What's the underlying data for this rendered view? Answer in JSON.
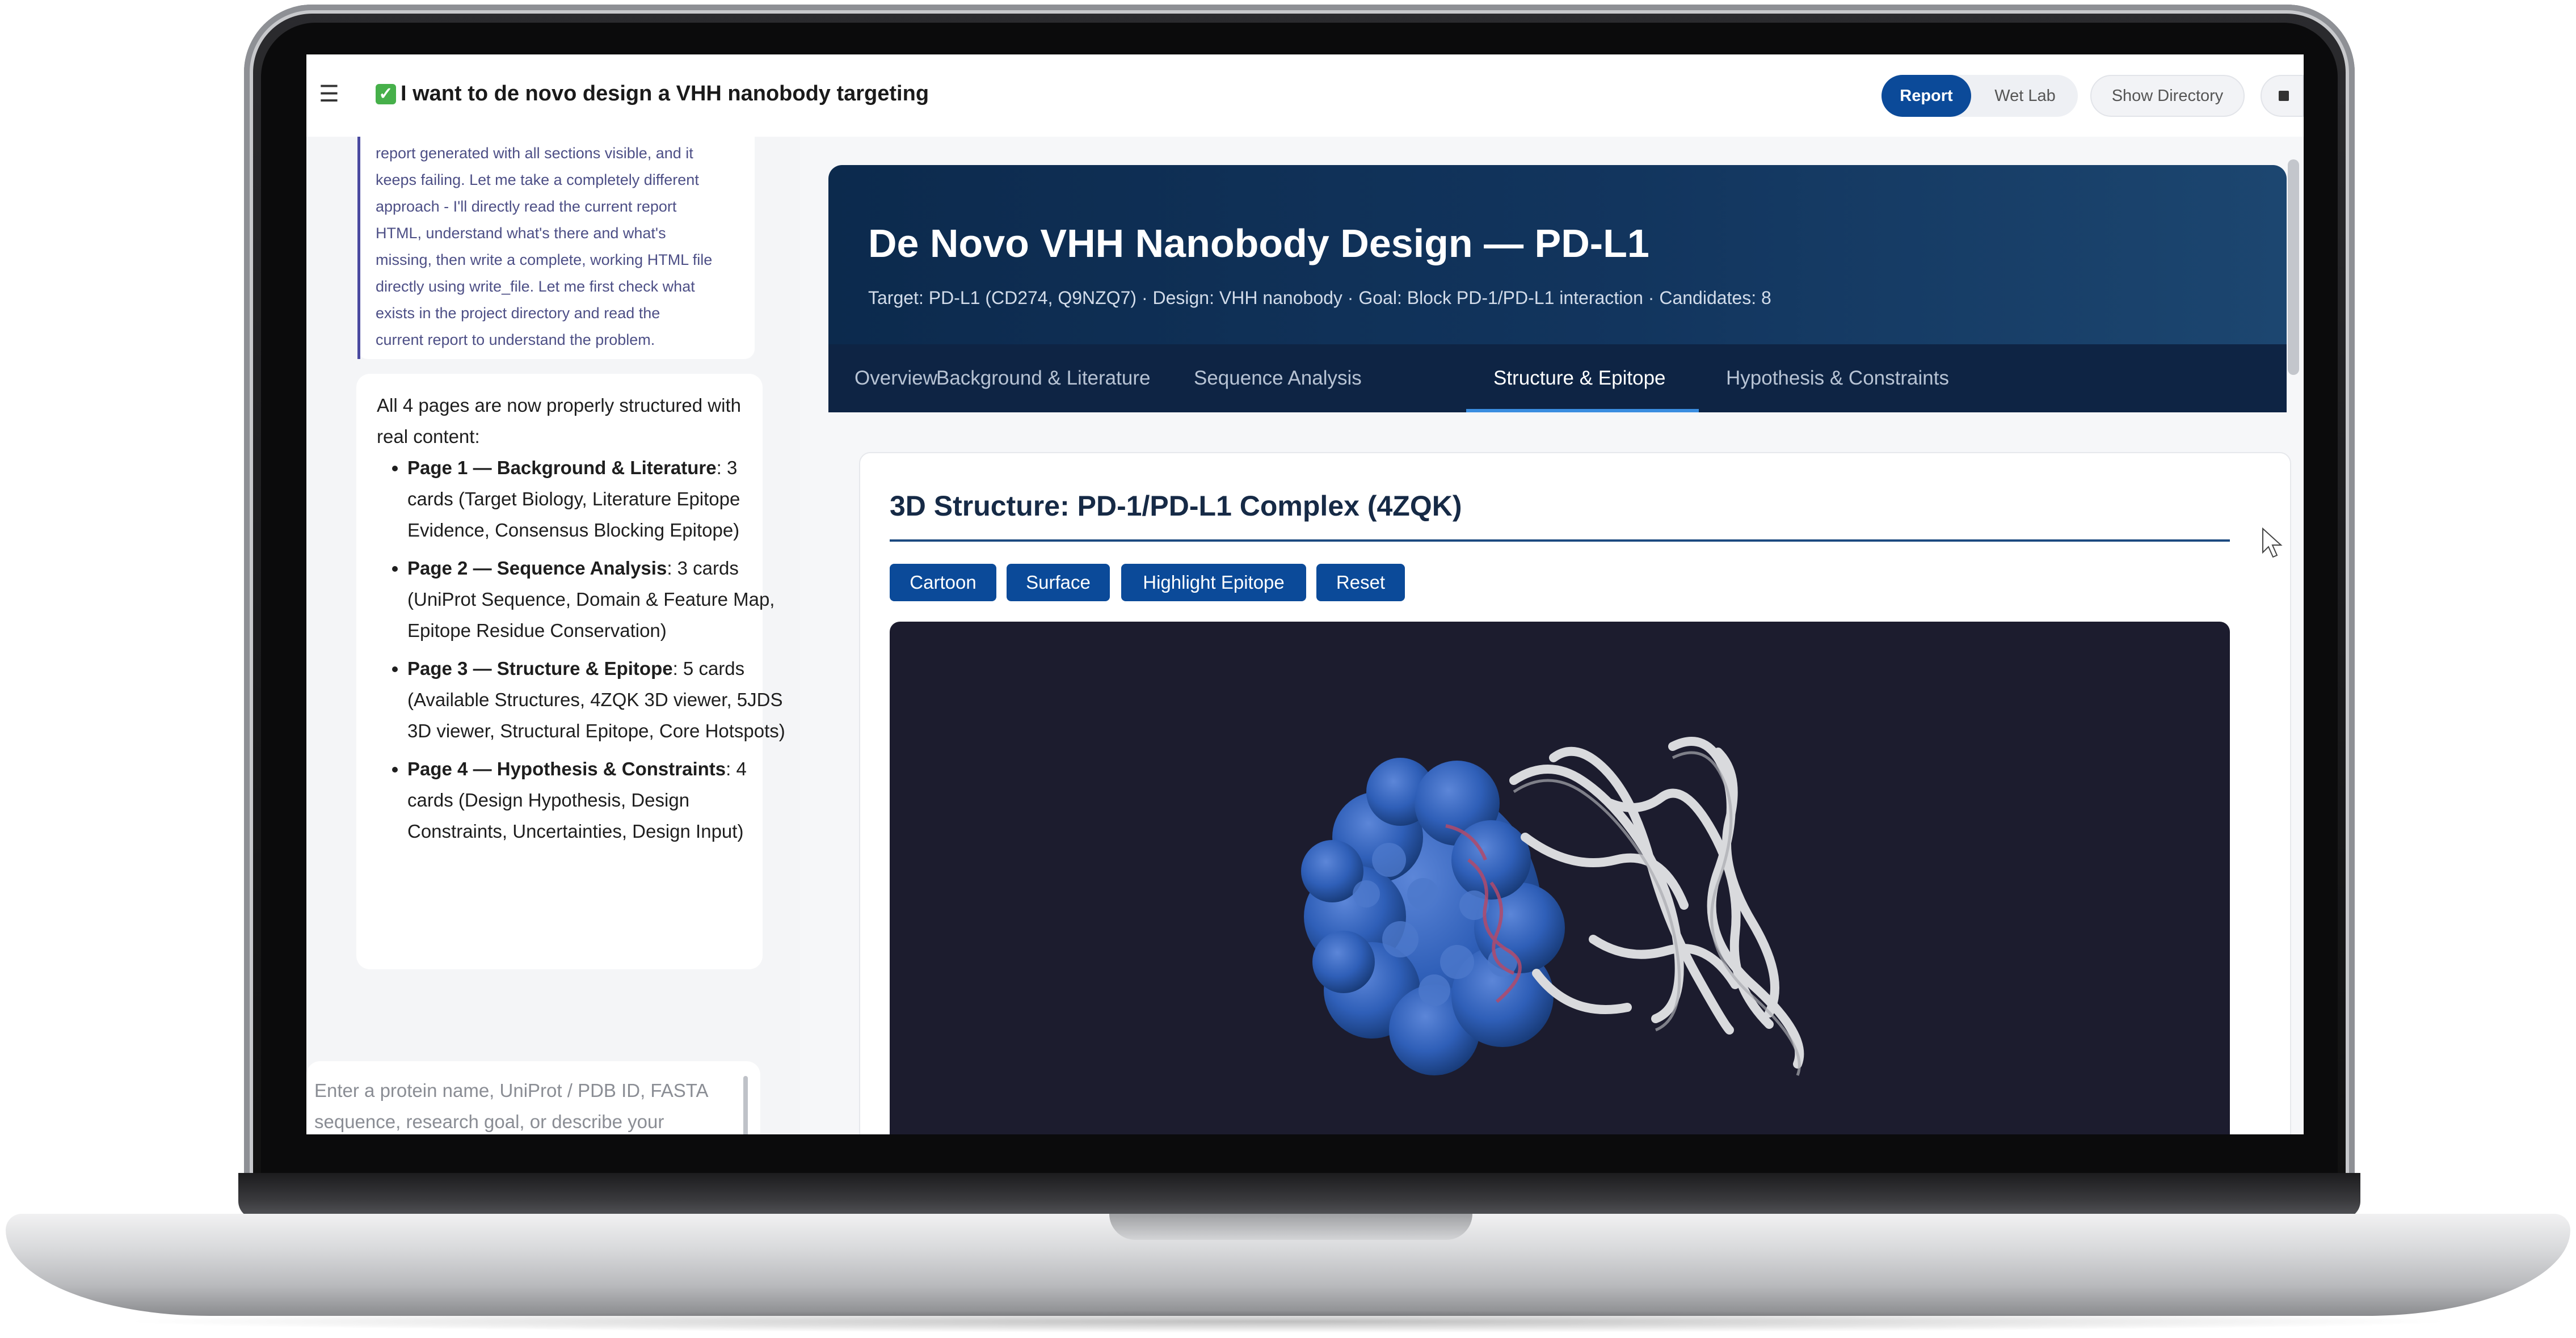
{
  "topbar": {
    "menu_icon": "hamburger-icon",
    "check_icon": "check-icon",
    "chat_title": "I want to de novo design a VHH nanobody targeting",
    "tabs": {
      "report": "Report",
      "wet_lab": "Wet Lab"
    },
    "show_directory": "Show Directory",
    "stop_icon": "stop-icon"
  },
  "chat": {
    "thought_lines": [
      "report generated with all sections visible, and it",
      "keeps failing. Let me take a completely different",
      "approach - I'll directly read the current report",
      "HTML, understand what's there and what's",
      "missing, then write a complete, working HTML file",
      "directly using write_file. Let me first check what",
      "exists in the project directory and read the",
      "current report to understand the problem."
    ],
    "message_intro": "All 4 pages are now properly structured with real content:",
    "items": [
      {
        "bold": "Page 1 — Background & Literature",
        "text": ": 3 cards (Target Biology, Literature Epitope Evidence, Consensus Blocking Epitope)"
      },
      {
        "bold": "Page 2 — Sequence Analysis",
        "text": ": 3 cards (UniProt Sequence, Domain & Feature Map, Epitope Residue Conservation)"
      },
      {
        "bold": "Page 3 — Structure & Epitope",
        "text": ": 5 cards (Available Structures, 4ZQK 3D viewer, 5JDS 3D viewer, Structural Epitope, Core Hotspots)"
      },
      {
        "bold": "Page 4 — Hypothesis & Constraints",
        "text": ": 4 cards (Design Hypothesis, Design Constraints, Uncertainties, Design Input)"
      }
    ],
    "input_placeholder": "Enter a protein name, UniProt / PDB ID, FASTA sequence, research goal, or describe your"
  },
  "report": {
    "title": "De Novo VHH Nanobody Design — PD-L1",
    "subtitle": "Target: PD-L1 (CD274, Q9NZQ7) · Design: VHH nanobody · Goal: Block PD-1/PD-L1 interaction · Candidates: 8",
    "tabs": [
      "Overview",
      "Background & Literature",
      "Sequence Analysis",
      "Structure & Epitope",
      "Hypothesis & Constraints"
    ],
    "active_tab": "Structure & Epitope",
    "card": {
      "title": "3D Structure: PD-1/PD-L1 Complex (4ZQK)",
      "buttons": [
        "Cartoon",
        "Surface",
        "Highlight Epitope",
        "Reset"
      ]
    }
  },
  "colors": {
    "accent": "#0b4a99",
    "hero_dark": "#0c2a4d",
    "viewer_bg": "#1c1c2e",
    "surface_blue": "#2f5fb8",
    "ribbon_white": "#d9dadd",
    "epitope_red": "#b24a6a"
  }
}
